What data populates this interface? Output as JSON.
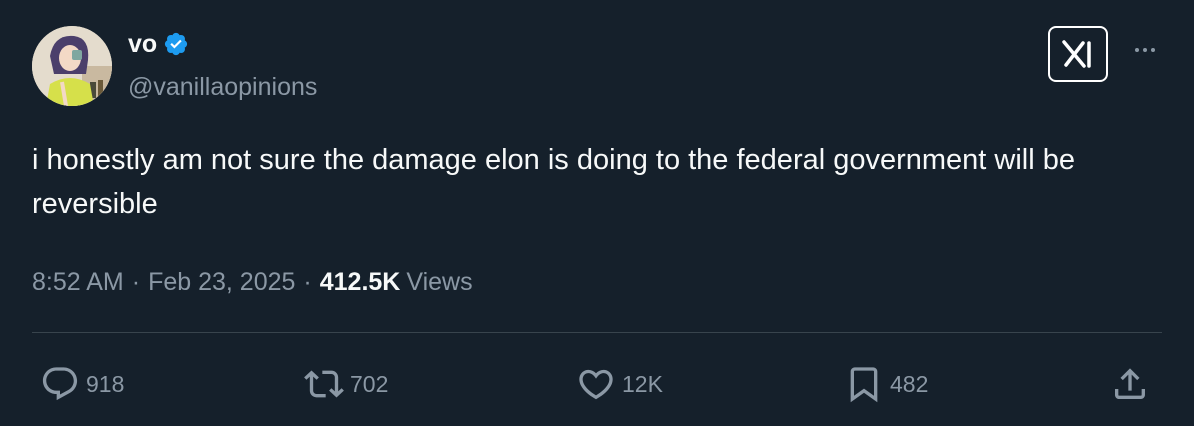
{
  "author": {
    "display_name": "vo",
    "handle": "@vanillaopinions",
    "verified": true,
    "badge_color": "#1d9bf0"
  },
  "tweet": {
    "text": "i honestly am not sure the damage elon is doing to the federal government will be reversible"
  },
  "meta": {
    "time": "8:52 AM",
    "separator": "·",
    "date": "Feb 23, 2025",
    "views_count": "412.5K",
    "views_label": "Views"
  },
  "actions": {
    "replies": "918",
    "retweets": "702",
    "likes": "12K",
    "bookmarks": "482"
  },
  "icons": {
    "more": "more-icon",
    "logo": "x-logo-icon",
    "reply": "reply-icon",
    "retweet": "retweet-icon",
    "like": "heart-icon",
    "bookmark": "bookmark-icon",
    "share": "share-icon"
  },
  "colors": {
    "background": "#15202b",
    "primary_text": "#f7f9f9",
    "secondary_text": "#8b98a5",
    "divider": "#38444d"
  }
}
